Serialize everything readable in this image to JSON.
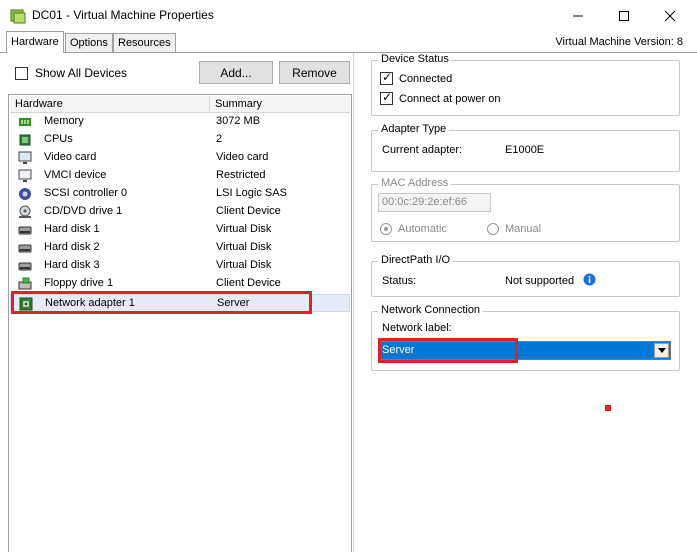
{
  "window": {
    "title": "DC01 - Virtual Machine Properties",
    "buttons": [
      "minimize-icon",
      "maximize-icon",
      "close-icon"
    ]
  },
  "tabs": [
    {
      "label": "Hardware",
      "active": true
    },
    {
      "label": "Options",
      "active": false
    },
    {
      "label": "Resources",
      "active": false
    }
  ],
  "vm_version": "Virtual Machine Version: 8",
  "toolbar": {
    "show_all_devices": "Show All Devices",
    "show_all_checked": false,
    "add_label": "Add...",
    "remove_label": "Remove"
  },
  "hardware_list": {
    "columns": [
      "Hardware",
      "Summary"
    ],
    "rows": [
      {
        "name": "Memory",
        "summary": "3072 MB",
        "icon": "memory-icon"
      },
      {
        "name": "CPUs",
        "summary": "2",
        "icon": "cpu-icon"
      },
      {
        "name": "Video card",
        "summary": "Video card",
        "icon": "monitor-icon"
      },
      {
        "name": "VMCI device",
        "summary": "Restricted",
        "icon": "vmci-icon"
      },
      {
        "name": "SCSI controller 0",
        "summary": "LSI Logic SAS",
        "icon": "scsi-icon"
      },
      {
        "name": "CD/DVD drive 1",
        "summary": "Client Device",
        "icon": "cd-icon"
      },
      {
        "name": "Hard disk 1",
        "summary": "Virtual Disk",
        "icon": "hard-disk-icon"
      },
      {
        "name": "Hard disk 2",
        "summary": "Virtual Disk",
        "icon": "hard-disk-icon"
      },
      {
        "name": "Hard disk 3",
        "summary": "Virtual Disk",
        "icon": "hard-disk-icon"
      },
      {
        "name": "Floppy drive 1",
        "summary": "Client Device",
        "icon": "floppy-icon"
      },
      {
        "name": "Network adapter 1",
        "summary": "Server",
        "icon": "network-adapter-icon",
        "selected": true
      }
    ]
  },
  "device_status": {
    "title": "Device Status",
    "connected": "Connected",
    "connected_checked": true,
    "connect_at_power_on": "Connect at power on",
    "connect_at_power_on_checked": true
  },
  "adapter_type": {
    "title": "Adapter Type",
    "label": "Current adapter:",
    "value": "E1000E"
  },
  "mac_address": {
    "title": "MAC Address",
    "value": "00:0c:29:2e:ef:66",
    "automatic": "Automatic",
    "manual": "Manual",
    "selected": "Automatic"
  },
  "directpath": {
    "title": "DirectPath I/O",
    "label": "Status:",
    "value": "Not supported"
  },
  "network_connection": {
    "title": "Network Connection",
    "label": "Network label:",
    "value": "Server"
  },
  "colors": {
    "highlight_red": "#e0202a",
    "selection_blue": "#0078d7",
    "info_blue": "#1e6fd9"
  }
}
